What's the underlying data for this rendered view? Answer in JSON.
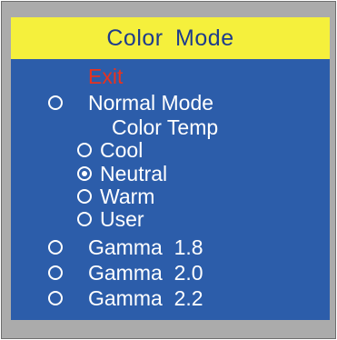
{
  "title": "Color Mode",
  "menu": {
    "exit_label": "Exit",
    "normal_mode_label": "Normal Mode",
    "color_temp_label": "Color Temp",
    "color_temp_options": [
      {
        "label": "Cool",
        "selected": false
      },
      {
        "label": "Neutral",
        "selected": true
      },
      {
        "label": "Warm",
        "selected": false
      },
      {
        "label": "User",
        "selected": false
      }
    ],
    "gamma_options": [
      {
        "label": "Gamma  1.8"
      },
      {
        "label": "Gamma  2.0"
      },
      {
        "label": "Gamma  2.2"
      }
    ]
  },
  "colors": {
    "title_bar": "#f5f03c",
    "title_text": "#1e3c8c",
    "panel_bg": "#2c5daa",
    "exit_text": "#e8321e",
    "frame": "#ababab"
  }
}
